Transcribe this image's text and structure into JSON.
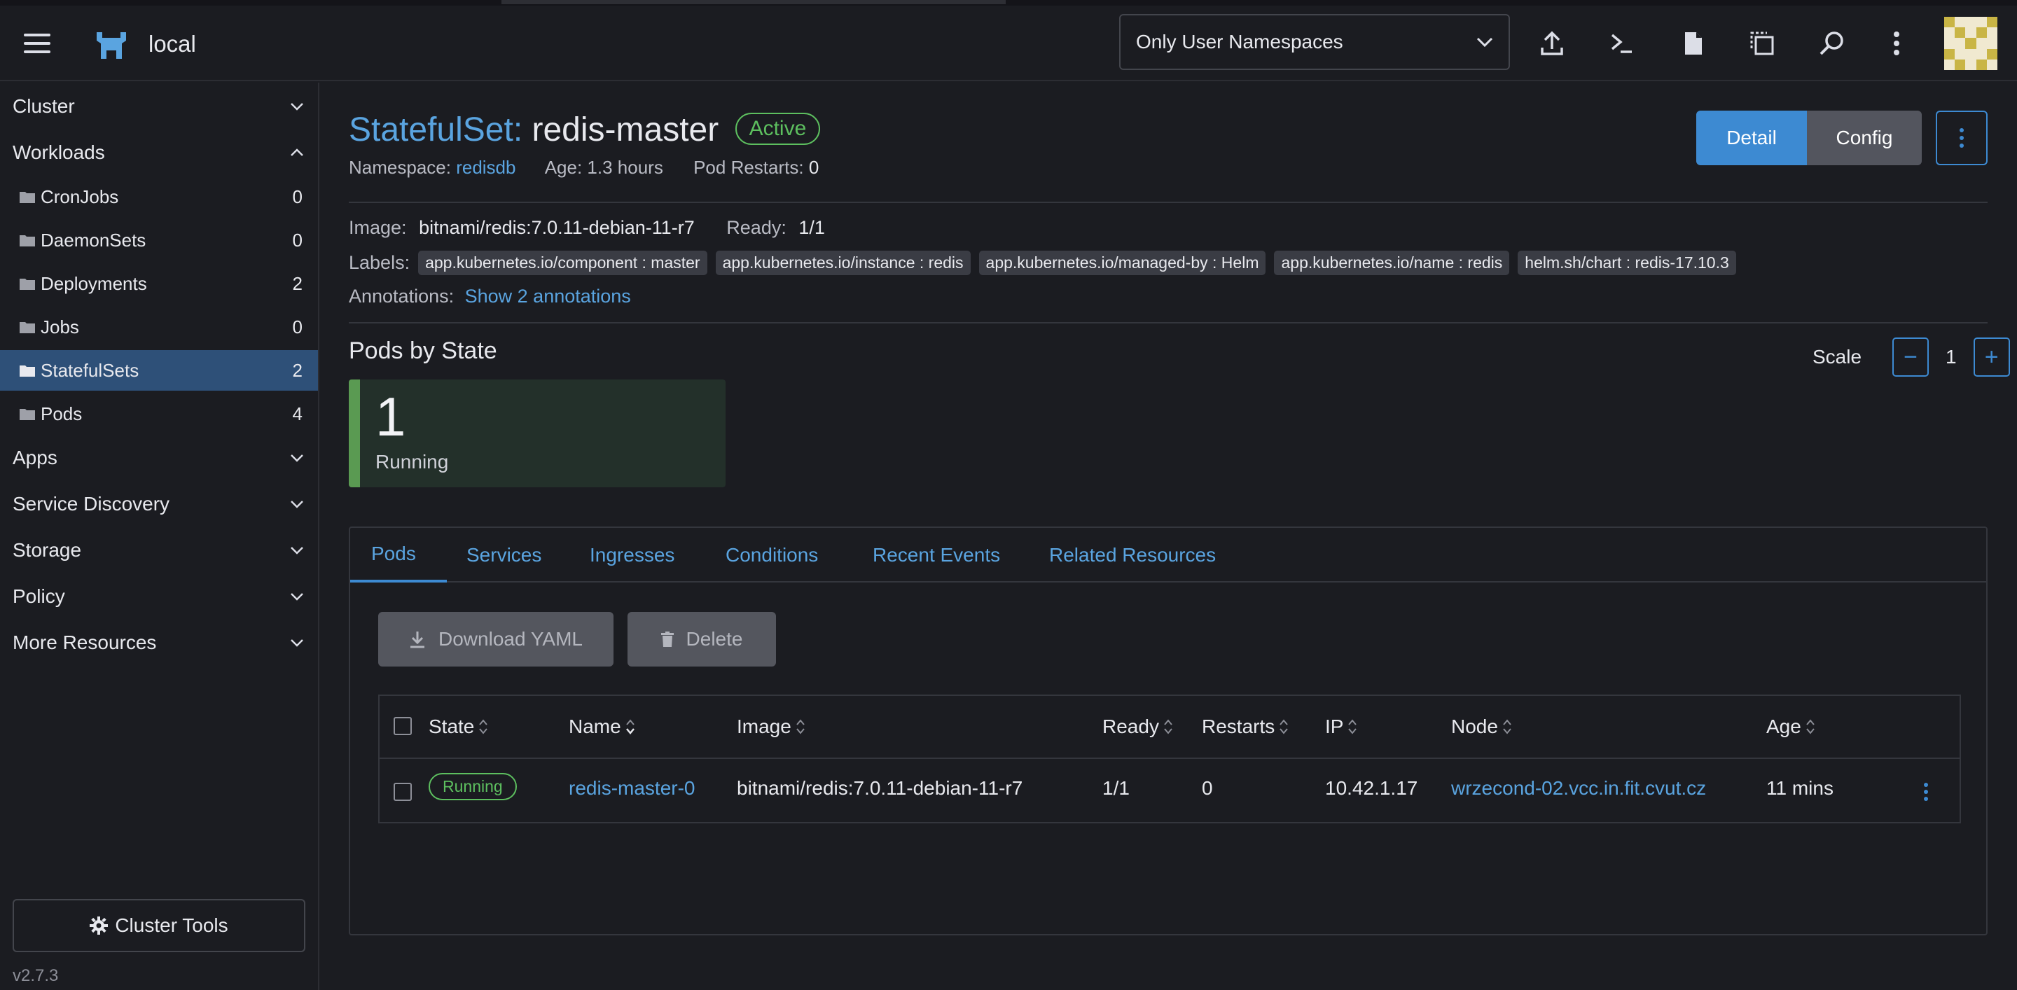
{
  "header": {
    "cluster_name": "local",
    "namespace_filter": "Only User Namespaces"
  },
  "sidebar": {
    "groups": {
      "cluster": "Cluster",
      "workloads": "Workloads",
      "apps": "Apps",
      "service_discovery": "Service Discovery",
      "storage": "Storage",
      "policy": "Policy",
      "more_resources": "More Resources"
    },
    "workload_items": [
      {
        "label": "CronJobs",
        "count": "0"
      },
      {
        "label": "DaemonSets",
        "count": "0"
      },
      {
        "label": "Deployments",
        "count": "2"
      },
      {
        "label": "Jobs",
        "count": "0"
      },
      {
        "label": "StatefulSets",
        "count": "2"
      },
      {
        "label": "Pods",
        "count": "4"
      }
    ],
    "cluster_tools": "Cluster Tools",
    "version": "v2.7.3"
  },
  "resource": {
    "kind": "StatefulSet:",
    "name": "redis-master",
    "status": "Active",
    "namespace_label": "Namespace:",
    "namespace": "redisdb",
    "age": "Age: 1.3 hours",
    "pod_restarts_label": "Pod Restarts:",
    "pod_restarts": "0",
    "image_label": "Image:",
    "image": "bitnami/redis:7.0.11-debian-11-r7",
    "ready_label": "Ready:",
    "ready": "1/1",
    "labels_label": "Labels:",
    "labels": [
      "app.kubernetes.io/component : master",
      "app.kubernetes.io/instance : redis",
      "app.kubernetes.io/managed-by : Helm",
      "app.kubernetes.io/name : redis",
      "helm.sh/chart : redis-17.10.3"
    ],
    "annotations_label": "Annotations:",
    "annotations_link": "Show 2 annotations"
  },
  "view_toggle": {
    "detail": "Detail",
    "config": "Config"
  },
  "pods_by_state": {
    "title": "Pods by State",
    "count": "1",
    "state": "Running"
  },
  "scale": {
    "label": "Scale",
    "value": "1",
    "minus": "−",
    "plus": "+"
  },
  "tabs": [
    "Pods",
    "Services",
    "Ingresses",
    "Conditions",
    "Recent Events",
    "Related Resources"
  ],
  "actions": {
    "download_yaml": "Download YAML",
    "delete": "Delete"
  },
  "table": {
    "headers": [
      "State",
      "Name",
      "Image",
      "Ready",
      "Restarts",
      "IP",
      "Node",
      "Age"
    ],
    "rows": [
      {
        "state": "Running",
        "name": "redis-master-0",
        "image": "bitnami/redis:7.0.11-debian-11-r7",
        "ready": "1/1",
        "restarts": "0",
        "ip": "10.42.1.17",
        "node": "wrzecond-02.vcc.in.fit.cvut.cz",
        "age": "11 mins"
      }
    ]
  },
  "colors": {
    "accent": "#3d8ad2",
    "link": "#5aa4e0",
    "success": "#5dbf5f",
    "background": "#1b1c21"
  }
}
